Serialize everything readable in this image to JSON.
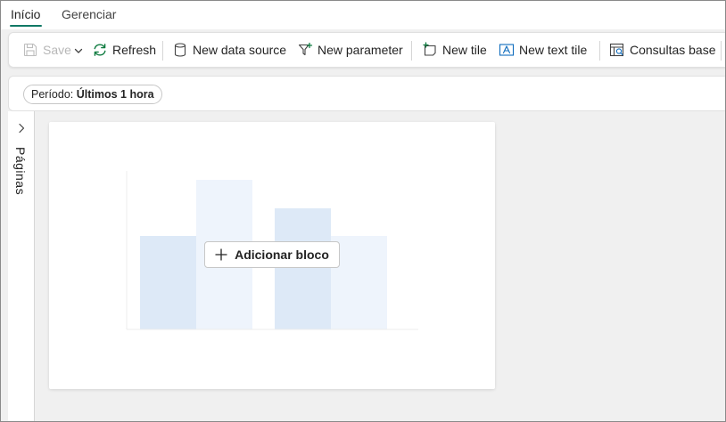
{
  "tabs": [
    {
      "label": "Início",
      "active": true
    },
    {
      "label": "Gerenciar",
      "active": false
    }
  ],
  "toolbar": {
    "save_label": "Save",
    "refresh_label": "Refresh",
    "new_data_source_label": "New data source",
    "new_parameter_label": "New parameter",
    "new_tile_label": "New tile",
    "new_text_tile_label": "New text tile",
    "consultas_base_label": "Consultas base"
  },
  "filter": {
    "prefix": "Período: ",
    "value": "Últimos 1 hora"
  },
  "pages_rail": {
    "label": "Páginas"
  },
  "canvas": {
    "add_block_label": "Adicionar bloco"
  },
  "colors": {
    "accent": "#117865",
    "refresh_icon": "#107c41",
    "icon_blue": "#0f6cbd",
    "placeholder_bar_dark": "#dde9f7",
    "placeholder_bar_light": "#eef4fc"
  }
}
